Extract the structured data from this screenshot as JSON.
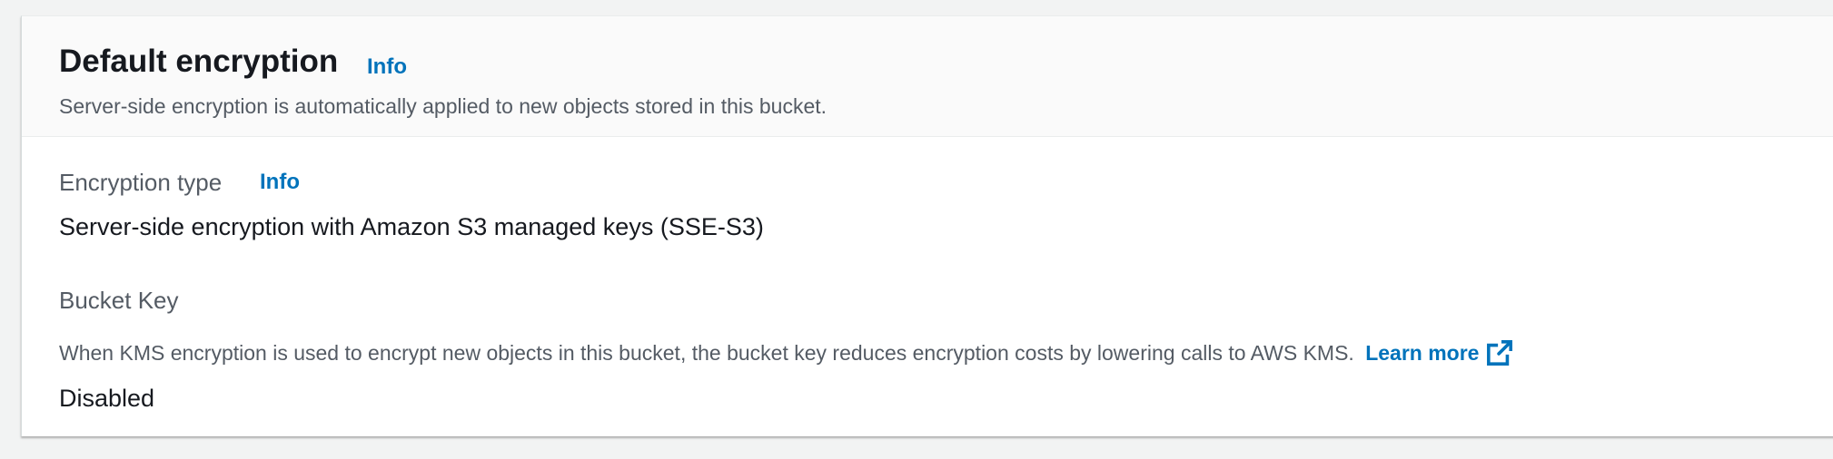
{
  "section": {
    "title": "Default encryption",
    "info_label": "Info",
    "description": "Server-side encryption is automatically applied to new objects stored in this bucket."
  },
  "encryption_type": {
    "label": "Encryption type",
    "info_label": "Info",
    "value": "Server-side encryption with Amazon S3 managed keys (SSE-S3)"
  },
  "bucket_key": {
    "label": "Bucket Key",
    "description": "When KMS encryption is used to encrypt new objects in this bucket, the bucket key reduces encryption costs by lowering calls to AWS KMS.",
    "learn_more_label": "Learn more",
    "learn_more_icon": "external-link-icon",
    "value": "Disabled"
  },
  "colors": {
    "link": "#0073bb",
    "text_primary": "#16191f",
    "text_secondary": "#545b64",
    "page_background": "#f2f3f3",
    "header_background": "#fafafa"
  }
}
